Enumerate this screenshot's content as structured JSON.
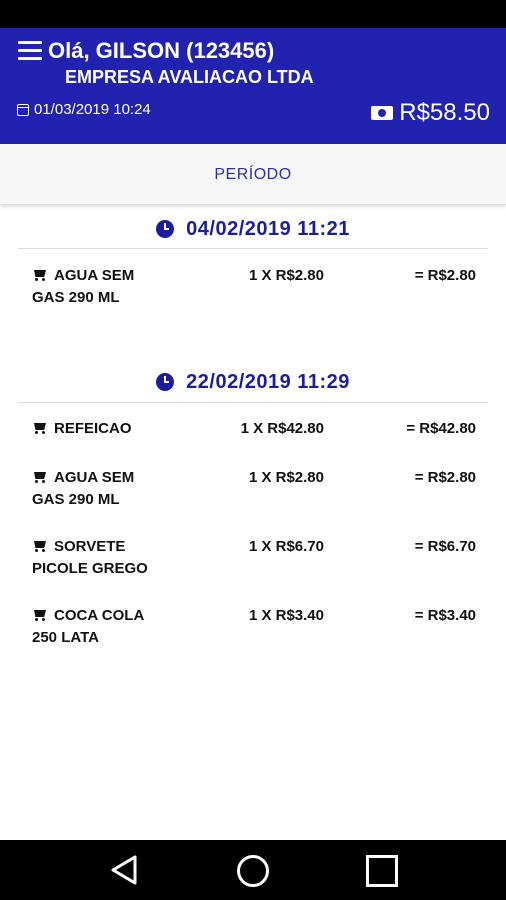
{
  "header": {
    "greeting": "Olá, GILSON (123456)",
    "company": "EMPRESA AVALIACAO LTDA",
    "datetime": "01/03/2019 10:24",
    "balance": "R$58.50"
  },
  "filter": {
    "period_label": "PERÍODO"
  },
  "groups": [
    {
      "datetime": "04/02/2019 11:21",
      "items": [
        {
          "name_line1": "AGUA SEM",
          "name_line2": "GAS 290 ML",
          "qty_price": "1 X R$2.80",
          "total": "= R$2.80"
        }
      ]
    },
    {
      "datetime": "22/02/2019 11:29",
      "items": [
        {
          "name_line1": "REFEICAO",
          "name_line2": "",
          "qty_price": "1 X R$42.80",
          "total": "= R$42.80"
        },
        {
          "name_line1": "AGUA SEM",
          "name_line2": "GAS 290 ML",
          "qty_price": "1 X R$2.80",
          "total": "= R$2.80"
        },
        {
          "name_line1": "SORVETE",
          "name_line2": "PICOLE GREGO",
          "qty_price": "1 X R$6.70",
          "total": "= R$6.70"
        },
        {
          "name_line1": "COCA COLA",
          "name_line2": "250 LATA",
          "qty_price": "1 X R$3.40",
          "total": "= R$3.40"
        }
      ]
    }
  ],
  "icons": {
    "menu": "menu-icon",
    "calendar": "calendar-icon",
    "money": "money-icon",
    "clock": "clock-icon",
    "cart": "cart-icon"
  },
  "colors": {
    "header_bg": "#2222b0",
    "accent": "#1c1c9e"
  }
}
